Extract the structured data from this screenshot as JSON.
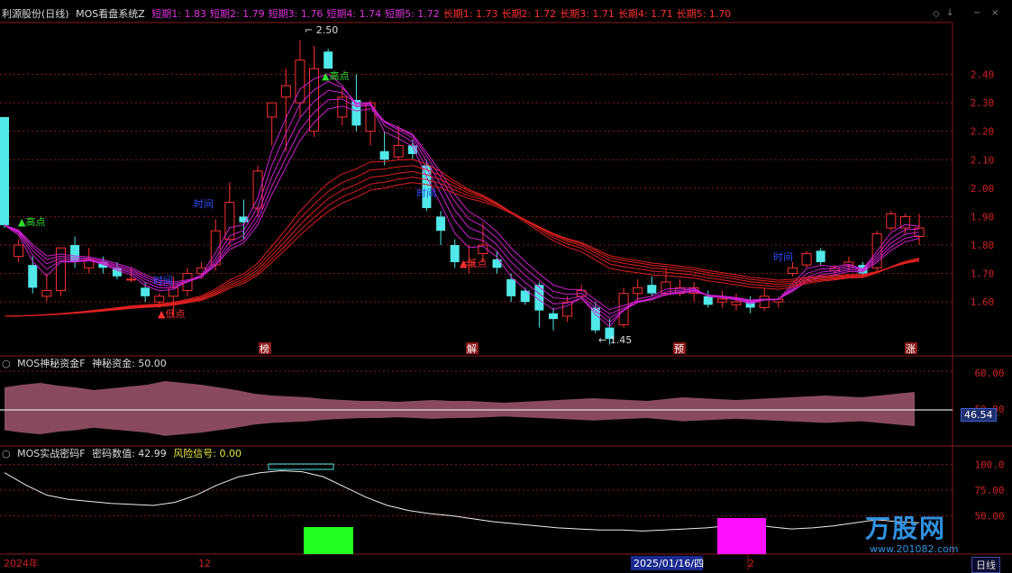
{
  "window": {
    "title": "利源股份(日线)"
  },
  "panel1": {
    "indicator": "MOS看盘系统Z",
    "params": [
      {
        "label": "短期1: 1.83",
        "color": "#e030e0"
      },
      {
        "label": "短期2: 1.79",
        "color": "#e030e0"
      },
      {
        "label": "短期3: 1.76",
        "color": "#e030e0"
      },
      {
        "label": "短期4: 1.74",
        "color": "#e030e0"
      },
      {
        "label": "短期5: 1.72",
        "color": "#e030e0"
      },
      {
        "label": "长期1: 1.73",
        "color": "#ff3030"
      },
      {
        "label": "长期2: 1.72",
        "color": "#ff3030"
      },
      {
        "label": "长期3: 1.71",
        "color": "#ff3030"
      },
      {
        "label": "长期4: 1.71",
        "color": "#ff3030"
      },
      {
        "label": "长期5: 1.70",
        "color": "#ff3030"
      }
    ],
    "yticks": [
      "2.40",
      "2.30",
      "2.20",
      "2.10",
      "2.00",
      "1.90",
      "1.80",
      "1.70",
      "1.60"
    ],
    "annotations": {
      "high_price": "2.50",
      "low_price": "1.45",
      "high1": "高点",
      "high2": "高点",
      "low1": "低点",
      "low2": "低点",
      "time1": "时间",
      "time2": "时间",
      "time3": "时间",
      "time4": "时间"
    },
    "bottom_tags": [
      "榜",
      "解",
      "预",
      "涨"
    ]
  },
  "panel2": {
    "indicator": "MOS神秘资金F",
    "value_label": "神秘资金: 50.00",
    "yticks": [
      "60.00",
      "50.00"
    ],
    "current": "46.54"
  },
  "panel3": {
    "indicator": "MOS实战密码F",
    "value_label": "密码数值: 42.99",
    "risk_label": "风险信号: 0.00",
    "yticks": [
      "100.0",
      "75.00",
      "50.00"
    ]
  },
  "xaxis": {
    "labels": [
      "2024年",
      "12",
      "2025/01/16/四",
      "2"
    ],
    "period": "日线"
  },
  "logo": {
    "name": "万股网",
    "url": "www.201082.com"
  },
  "colors": {
    "up": "#ff3030",
    "down": "#50e8e8",
    "grid": "#8b1a1a",
    "bg": "#000000"
  },
  "chart_data": {
    "type": "candlestick",
    "ylim": [
      1.42,
      2.56
    ],
    "candles": [
      [
        2.25,
        1.87,
        2.25,
        1.86
      ],
      [
        1.76,
        1.8,
        1.82,
        1.74
      ],
      [
        1.73,
        1.65,
        1.76,
        1.63
      ],
      [
        1.62,
        1.64,
        1.7,
        1.6
      ],
      [
        1.64,
        1.79,
        1.79,
        1.62
      ],
      [
        1.8,
        1.74,
        1.83,
        1.72
      ],
      [
        1.72,
        1.75,
        1.79,
        1.7
      ],
      [
        1.74,
        1.72,
        1.76,
        1.7
      ],
      [
        1.72,
        1.69,
        1.74,
        1.68
      ],
      [
        1.68,
        1.68,
        1.72,
        1.67
      ],
      [
        1.65,
        1.62,
        1.67,
        1.6
      ],
      [
        1.6,
        1.62,
        1.63,
        1.58
      ],
      [
        1.62,
        1.65,
        1.69,
        1.55
      ],
      [
        1.64,
        1.7,
        1.72,
        1.62
      ],
      [
        1.7,
        1.72,
        1.74,
        1.68
      ],
      [
        1.73,
        1.85,
        1.89,
        1.71
      ],
      [
        1.82,
        1.95,
        2.02,
        1.8
      ],
      [
        1.9,
        1.88,
        1.96,
        1.82
      ],
      [
        1.93,
        2.06,
        2.08,
        1.9
      ],
      [
        2.25,
        2.3,
        2.3,
        2.15
      ],
      [
        2.32,
        2.36,
        2.42,
        2.13
      ],
      [
        2.3,
        2.45,
        2.52,
        2.25
      ],
      [
        2.2,
        2.42,
        2.5,
        2.18
      ],
      [
        2.48,
        2.42,
        2.49,
        2.42
      ],
      [
        2.25,
        2.32,
        2.35,
        2.22
      ],
      [
        2.31,
        2.22,
        2.4,
        2.2
      ],
      [
        2.2,
        2.3,
        2.31,
        2.15
      ],
      [
        2.13,
        2.1,
        2.2,
        2.08
      ],
      [
        2.11,
        2.15,
        2.22,
        2.1
      ],
      [
        2.15,
        2.12,
        2.17,
        2.1
      ],
      [
        2.08,
        1.93,
        2.1,
        1.92
      ],
      [
        1.9,
        1.85,
        1.92,
        1.8
      ],
      [
        1.8,
        1.74,
        1.82,
        1.72
      ],
      [
        1.73,
        1.74,
        1.8,
        1.7
      ],
      [
        1.77,
        1.8,
        1.88,
        1.74
      ],
      [
        1.75,
        1.72,
        1.78,
        1.7
      ],
      [
        1.68,
        1.62,
        1.7,
        1.6
      ],
      [
        1.64,
        1.6,
        1.65,
        1.59
      ],
      [
        1.66,
        1.57,
        1.67,
        1.51
      ],
      [
        1.56,
        1.54,
        1.58,
        1.5
      ],
      [
        1.55,
        1.6,
        1.62,
        1.53
      ],
      [
        1.62,
        1.64,
        1.66,
        1.61
      ],
      [
        1.58,
        1.5,
        1.6,
        1.49
      ],
      [
        1.51,
        1.47,
        1.54,
        1.45
      ],
      [
        1.52,
        1.63,
        1.65,
        1.51
      ],
      [
        1.63,
        1.65,
        1.68,
        1.6
      ],
      [
        1.66,
        1.63,
        1.69,
        1.62
      ],
      [
        1.63,
        1.67,
        1.72,
        1.62
      ],
      [
        1.63,
        1.65,
        1.68,
        1.62
      ],
      [
        1.63,
        1.65,
        1.67,
        1.6
      ],
      [
        1.62,
        1.59,
        1.64,
        1.58
      ],
      [
        1.6,
        1.61,
        1.64,
        1.58
      ],
      [
        1.59,
        1.6,
        1.63,
        1.57
      ],
      [
        1.6,
        1.58,
        1.62,
        1.56
      ],
      [
        1.58,
        1.62,
        1.65,
        1.57
      ],
      [
        1.6,
        1.61,
        1.62,
        1.58
      ],
      [
        1.7,
        1.72,
        1.74,
        1.69
      ],
      [
        1.73,
        1.77,
        1.78,
        1.72
      ],
      [
        1.78,
        1.74,
        1.79,
        1.73
      ],
      [
        1.71,
        1.72,
        1.73,
        1.7
      ],
      [
        1.73,
        1.74,
        1.76,
        1.71
      ],
      [
        1.73,
        1.7,
        1.74,
        1.69
      ],
      [
        1.72,
        1.84,
        1.85,
        1.7
      ],
      [
        1.86,
        1.91,
        1.92,
        1.85
      ],
      [
        1.86,
        1.9,
        1.91,
        1.84
      ],
      [
        1.83,
        1.86,
        1.91,
        1.8
      ]
    ]
  }
}
